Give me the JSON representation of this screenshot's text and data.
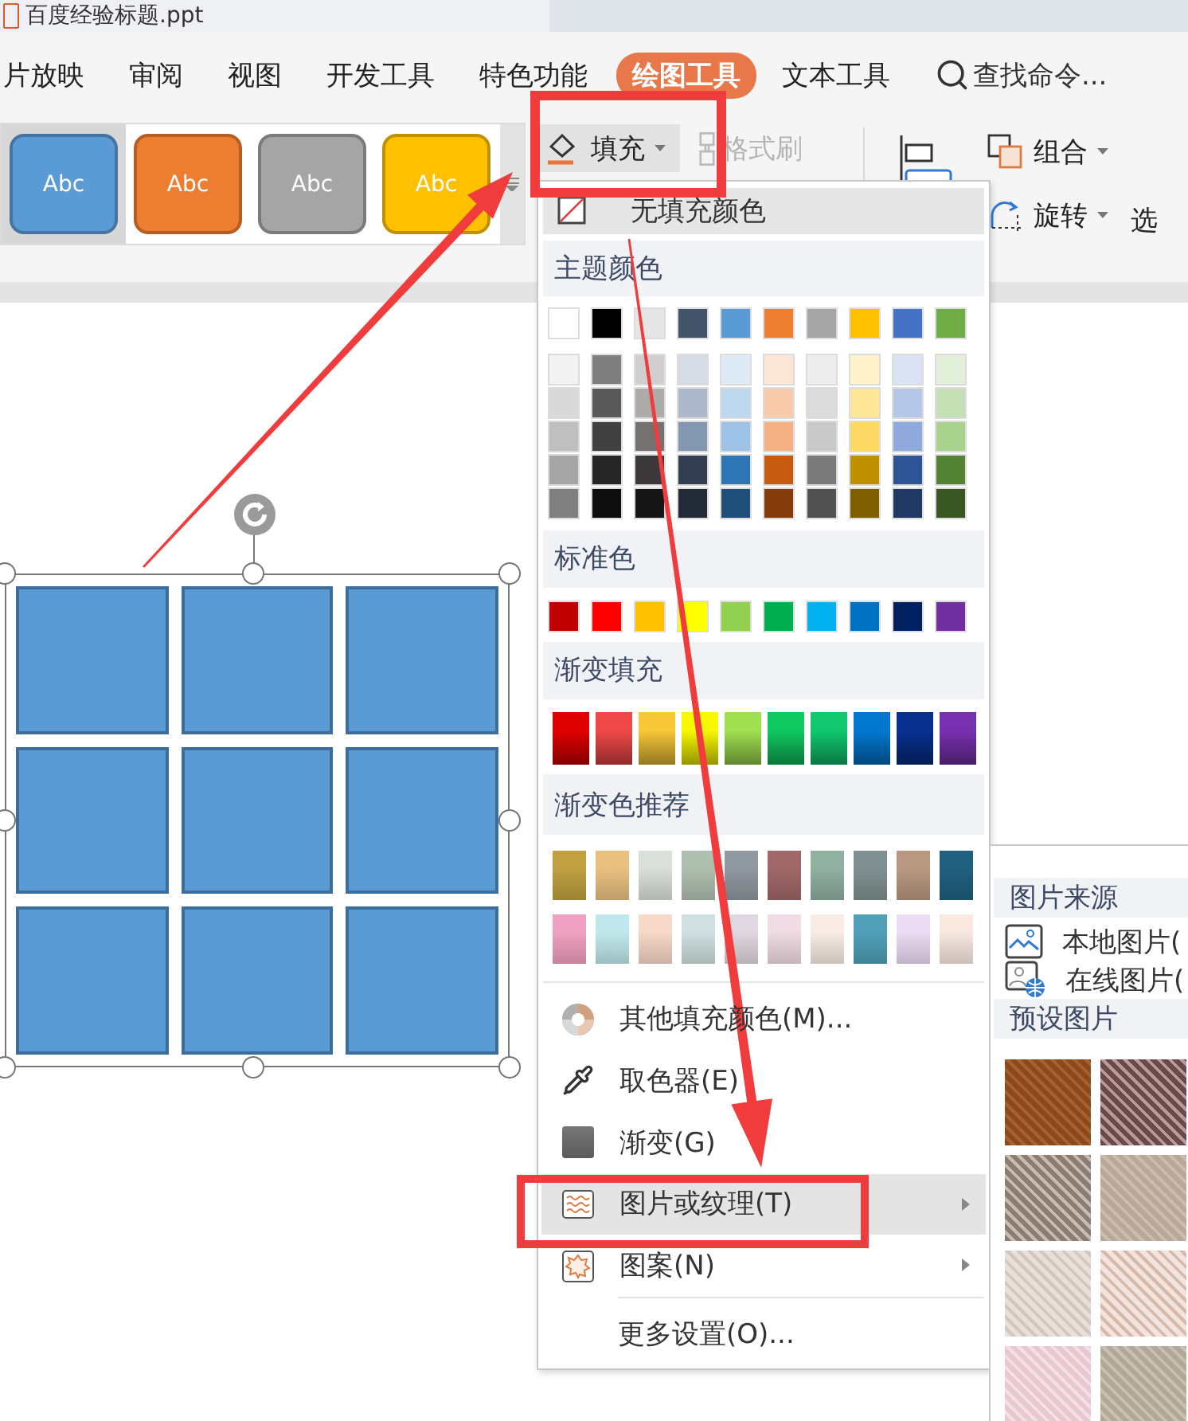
{
  "document_tab": {
    "title": "百度经验标题.ppt"
  },
  "menu_tabs": [
    {
      "label": "片放映",
      "selected": false
    },
    {
      "label": "审阅",
      "selected": false
    },
    {
      "label": "视图",
      "selected": false
    },
    {
      "label": "开发工具",
      "selected": false
    },
    {
      "label": "特色功能",
      "selected": false
    },
    {
      "label": "绘图工具",
      "selected": true
    },
    {
      "label": "文本工具",
      "selected": false
    }
  ],
  "search": {
    "label": "查找命令..."
  },
  "style_gallery": [
    {
      "label": "Abc",
      "color": "#5b9bd5",
      "selected": true
    },
    {
      "label": "Abc",
      "color": "#ed7d31",
      "selected": false
    },
    {
      "label": "Abc",
      "color": "#a5a5a5",
      "selected": false
    },
    {
      "label": "Abc",
      "color": "#ffc000",
      "selected": false
    }
  ],
  "toolbar": {
    "fill_button": "填充",
    "format_painter": {
      "label": "格式刷",
      "disabled": true
    },
    "group_button": "组合",
    "rotate_button": "旋转",
    "select_button": "选"
  },
  "fill_menu": {
    "no_fill": {
      "label": "无填充颜色",
      "highlighted": true
    },
    "theme_header": "主题颜色",
    "theme_colors": [
      {
        "color": "#ffffff"
      },
      {
        "color": "#000000"
      },
      {
        "color": "#e7e6e6"
      },
      {
        "color": "#44546a"
      },
      {
        "color": "#5b9bd5"
      },
      {
        "color": "#ed7d31"
      },
      {
        "color": "#a5a5a5"
      },
      {
        "color": "#ffc000"
      },
      {
        "color": "#4472c4"
      },
      {
        "color": "#70ad47"
      }
    ],
    "theme_shades": [
      [
        {
          "color": "#f2f2f2"
        },
        {
          "color": "#7f7f7f"
        },
        {
          "color": "#d0cece"
        },
        {
          "color": "#d6dce5"
        },
        {
          "color": "#deebf7"
        },
        {
          "color": "#fbe5d6"
        },
        {
          "color": "#ededed"
        },
        {
          "color": "#fff2cc"
        },
        {
          "color": "#dae3f3"
        },
        {
          "color": "#e2f0d9"
        }
      ],
      [
        {
          "color": "#d9d9d9"
        },
        {
          "color": "#595959"
        },
        {
          "color": "#aeabab"
        },
        {
          "color": "#adb9ca"
        },
        {
          "color": "#bdd7ee"
        },
        {
          "color": "#f8cbad"
        },
        {
          "color": "#dbdbdb"
        },
        {
          "color": "#ffe699"
        },
        {
          "color": "#b4c7e7"
        },
        {
          "color": "#c5e0b4"
        }
      ],
      [
        {
          "color": "#bfbfbf"
        },
        {
          "color": "#404040"
        },
        {
          "color": "#757171"
        },
        {
          "color": "#8497b0"
        },
        {
          "color": "#9dc3e6"
        },
        {
          "color": "#f4b183"
        },
        {
          "color": "#c9c9c9"
        },
        {
          "color": "#ffd966"
        },
        {
          "color": "#8faadc"
        },
        {
          "color": "#a9d18e"
        }
      ],
      [
        {
          "color": "#a6a6a6"
        },
        {
          "color": "#262626"
        },
        {
          "color": "#3a3838"
        },
        {
          "color": "#333f50"
        },
        {
          "color": "#2e75b6"
        },
        {
          "color": "#c55a11"
        },
        {
          "color": "#7b7b7b"
        },
        {
          "color": "#bf9000"
        },
        {
          "color": "#2f5597"
        },
        {
          "color": "#548235"
        }
      ],
      [
        {
          "color": "#808080"
        },
        {
          "color": "#0d0d0d"
        },
        {
          "color": "#171616"
        },
        {
          "color": "#222a35"
        },
        {
          "color": "#1f4e79"
        },
        {
          "color": "#843c0c"
        },
        {
          "color": "#525252"
        },
        {
          "color": "#7f6000"
        },
        {
          "color": "#203864"
        },
        {
          "color": "#385723"
        }
      ]
    ],
    "standard_header": "标准色",
    "standard_colors": [
      {
        "color": "#c00000"
      },
      {
        "color": "#ff0000"
      },
      {
        "color": "#ffc000"
      },
      {
        "color": "#ffff00"
      },
      {
        "color": "#92d050"
      },
      {
        "color": "#00b050"
      },
      {
        "color": "#00b0f0"
      },
      {
        "color": "#0070c0"
      },
      {
        "color": "#002060"
      },
      {
        "color": "#7030a0"
      }
    ],
    "gradient_header": "渐变填充",
    "gradients": [
      {
        "color": "#e00000"
      },
      {
        "color": "#f04848"
      },
      {
        "color": "#f8c838"
      },
      {
        "color": "#f8f800"
      },
      {
        "color": "#a0e050"
      },
      {
        "color": "#10c860"
      },
      {
        "color": "#10c870"
      },
      {
        "color": "#0078d0"
      },
      {
        "color": "#083090"
      },
      {
        "color": "#7830b0"
      }
    ],
    "recommended_header": "渐变色推荐",
    "recommended": [
      [
        {
          "color": "#c0a040"
        },
        {
          "color": "#e8c080"
        },
        {
          "color": "#d8e0d8"
        },
        {
          "color": "#b0c0b0"
        },
        {
          "color": "#9098a0"
        },
        {
          "color": "#a06868"
        },
        {
          "color": "#90b0a0"
        },
        {
          "color": "#809090"
        },
        {
          "color": "#b89880"
        },
        {
          "color": "#206080"
        }
      ],
      [
        {
          "color": "#f0a0c0"
        },
        {
          "color": "#c0e8ec"
        },
        {
          "color": "#f8d8c8"
        },
        {
          "color": "#d0e0e0"
        },
        {
          "color": "#e0d8e0"
        },
        {
          "color": "#f0dce4"
        },
        {
          "color": "#f8ece4"
        },
        {
          "color": "#50a0b8"
        },
        {
          "color": "#ecdcf4"
        },
        {
          "color": "#f8e8e0"
        }
      ]
    ],
    "items": [
      {
        "label": "其他填充颜色(M)...",
        "kind": "palette",
        "submenu": false,
        "highlighted": false
      },
      {
        "label": "取色器(E)",
        "kind": "eyedropper",
        "submenu": false,
        "highlighted": false
      },
      {
        "label": "渐变(G)",
        "kind": "gradient",
        "submenu": false,
        "highlighted": false
      },
      {
        "label": "图片或纹理(T)",
        "kind": "texture",
        "submenu": true,
        "highlighted": true
      },
      {
        "label": "图案(N)",
        "kind": "pattern",
        "submenu": true,
        "highlighted": false
      }
    ],
    "more_settings": "更多设置(O)..."
  },
  "texture_menu": {
    "source_header": "图片来源",
    "sources": [
      {
        "label": "本地图片(",
        "kind": "local"
      },
      {
        "label": "在线图片(",
        "kind": "online"
      }
    ],
    "preset_header": "预设图片"
  }
}
